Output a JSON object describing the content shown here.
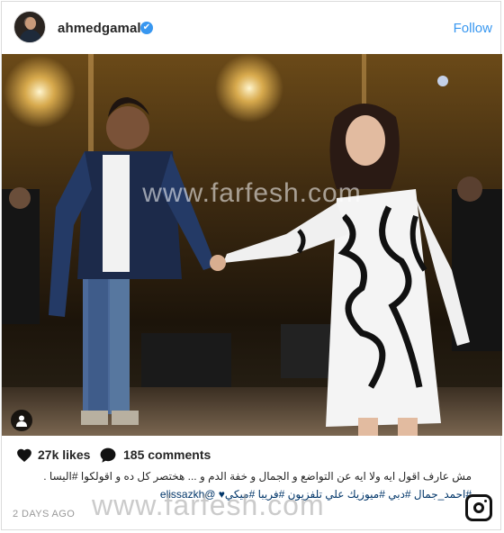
{
  "header": {
    "username": "ahmedgamal",
    "verified_mark": "✔",
    "follow_label": "Follow"
  },
  "photo": {
    "watermark": "www.farfesh.com"
  },
  "stats": {
    "likes": "27k likes",
    "comments": "185 comments"
  },
  "caption": {
    "line1": "مش عارف اقول ايه ولا ايه عن التواضع و الجمال و خفة الدم و ... هختصر كل ده و اقولكوا #اليسا .",
    "line2": "#احمد_جمال #دبي #ميوزيك علي تلفزيون #فريبا #ميكي♥ @elissazkh"
  },
  "timestamp": "2 DAYS AGO",
  "bottom_watermark": "www.farfesh.com",
  "colors": {
    "accent": "#3897f0",
    "text": "#262626",
    "muted": "#999999",
    "hashtag": "#003569"
  },
  "icons": [
    "verified-icon",
    "person-tag-icon",
    "heart-icon",
    "comment-icon",
    "instagram-logo-icon"
  ]
}
